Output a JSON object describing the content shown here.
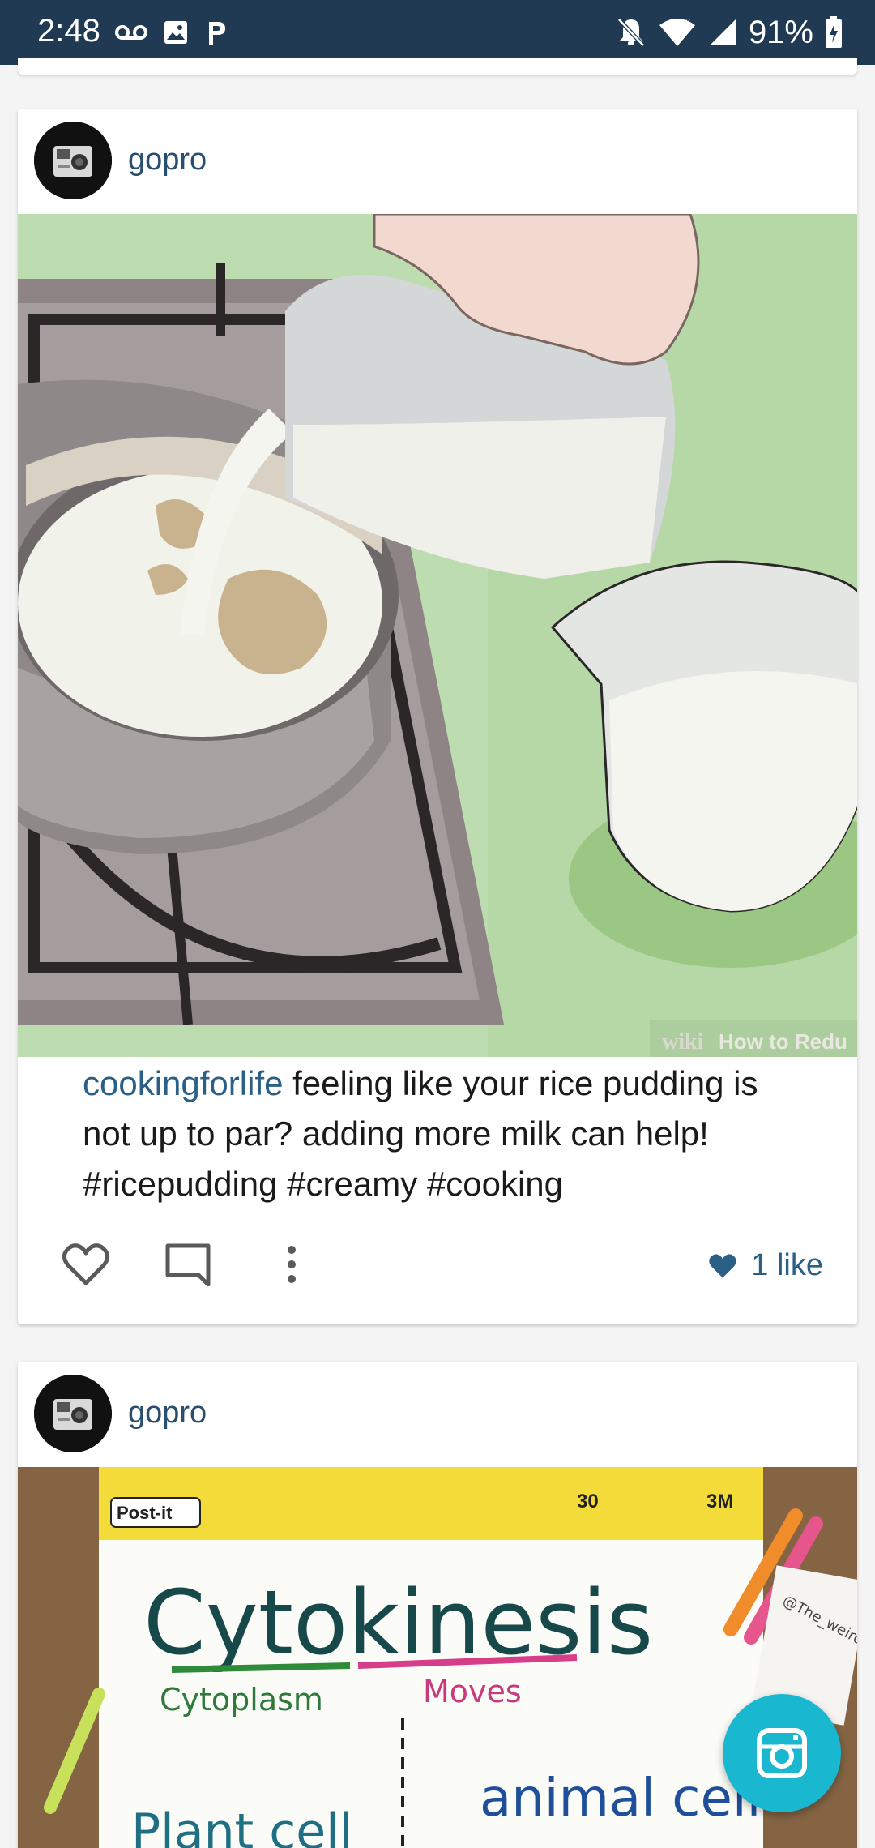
{
  "status_bar": {
    "time": "2:48",
    "battery_percent": "91%",
    "left_icons": [
      "voicemail-icon",
      "image-icon",
      "p-icon"
    ],
    "right_icons": [
      "notifications-off-icon",
      "wifi-icon",
      "signal-icon",
      "battery-charging-icon"
    ]
  },
  "posts": [
    {
      "username": "gopro",
      "image_watermark": {
        "brand": "wiki",
        "text": "How to Redu"
      },
      "caption_user": "cookingforlife",
      "caption_text": " feeling like your rice pudding is not up to par? adding more milk can help! #ricepudding #creamy #cooking",
      "likes": "1 like"
    },
    {
      "username": "gopro",
      "image_text": {
        "pad_brand": "Post-it",
        "pad_count": "30",
        "pad_maker": "3M",
        "title": "Cytokinesis",
        "word_left": "Cytoplasm",
        "word_right": "Moves",
        "bottom_left": "Plant cell",
        "bottom_right": "animal cell",
        "note": "@The_weird_science_teacher"
      }
    }
  ],
  "colors": {
    "status_bar": "#1f3a52",
    "accent": "#2a5f86",
    "fab": "#1ab7d0"
  }
}
